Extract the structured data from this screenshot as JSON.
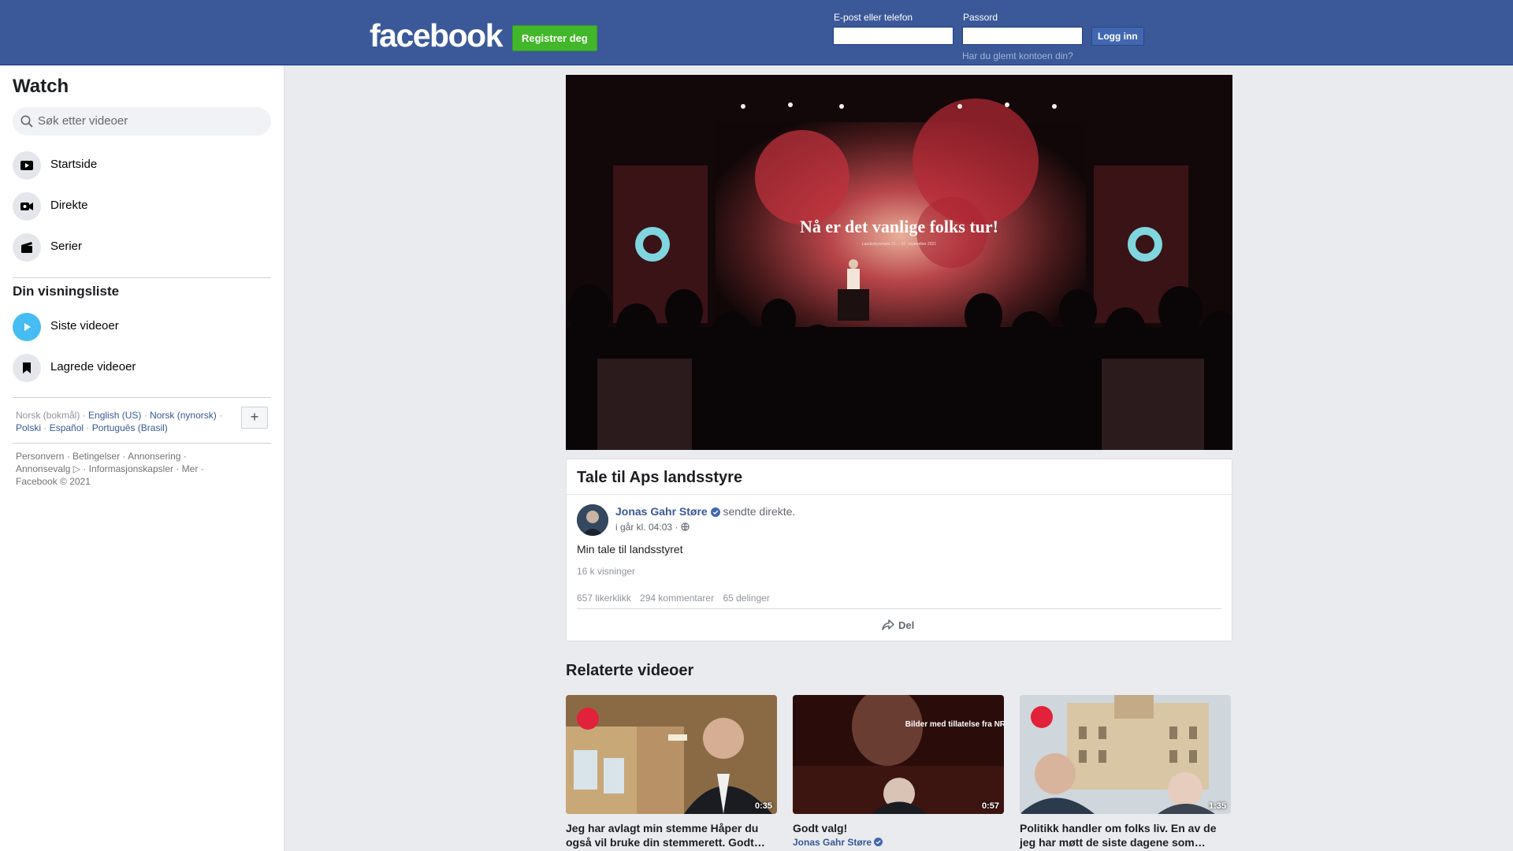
{
  "header": {
    "logo": "facebook",
    "register_label": "Registrer deg",
    "email_label": "E-post eller telefon",
    "password_label": "Passord",
    "email_value": "",
    "password_value": "",
    "login_label": "Logg inn",
    "forgot_label": "Har du glemt kontoen din?"
  },
  "sidebar": {
    "title": "Watch",
    "search_placeholder": "Søk etter videoer",
    "nav": [
      {
        "label": "Startside",
        "icon": "play-screen-icon"
      },
      {
        "label": "Direkte",
        "icon": "live-camera-icon"
      },
      {
        "label": "Serier",
        "icon": "clapperboard-icon"
      }
    ],
    "watchlist_title": "Din visningsliste",
    "watchlist": [
      {
        "label": "Siste videoer",
        "icon": "play-circle-icon"
      },
      {
        "label": "Lagrede videoer",
        "icon": "bookmark-icon"
      }
    ],
    "languages": {
      "current": "Norsk (bokmål)",
      "options": [
        "English (US)",
        "Norsk (nynorsk)",
        "Polski",
        "Español",
        "Português (Brasil)"
      ]
    },
    "more_languages": "+",
    "footer": "Personvern · Betingelser · Annonsering · Annonsevalg ▷ · Informasjonskapsler · Mer · Facebook © 2021"
  },
  "video": {
    "slide_text": "Nå er det vanlige folks tur!",
    "slide_subtext": "Landsstyremøte 21. – 22. september 2021"
  },
  "post": {
    "title": "Tale til Aps landsstyre",
    "author": "Jonas Gahr Støre",
    "verb": "sendte direkte.",
    "time": "i går kl. 04:03 ·",
    "text": "Min tale til landsstyret",
    "views": "16 k visninger",
    "likes": "657 likerklikk",
    "comments": "294 kommentarer",
    "shares": "65 delinger",
    "share_label": "Del"
  },
  "related": {
    "title": "Relaterte videoer",
    "videos": [
      {
        "duration": "0:35",
        "title": "Jeg har avlagt min stemme Håper du også vil bruke din stemmerett. Godt…",
        "author": ""
      },
      {
        "duration": "0:57",
        "title": "Godt valg!",
        "author": "Jonas Gahr Støre",
        "overlay": "Bilder med tillatelse fra NRK"
      },
      {
        "duration": "1:35",
        "title": " Politikk handler om folks liv. En av de jeg har møtt de siste dagene som…",
        "author": ""
      }
    ]
  },
  "colors": {
    "brand": "#3b5998",
    "register": "#42b72a",
    "link": "#385898",
    "page_bg": "#e9ebee"
  }
}
